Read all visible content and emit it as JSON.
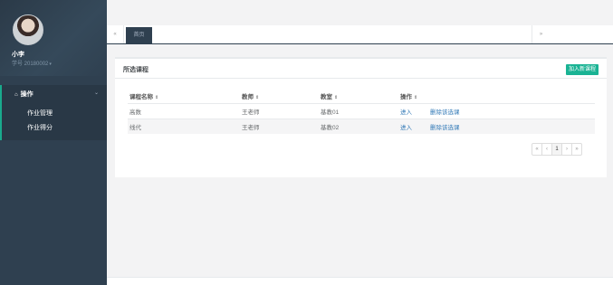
{
  "user": {
    "name": "小李",
    "id_label": "学号 20180002",
    "caret": "▾"
  },
  "nav": {
    "section_icon": "⌂",
    "section_label": "操作",
    "chevron": "⌄",
    "items": [
      {
        "label": "作业管理"
      },
      {
        "label": "作业得分"
      }
    ]
  },
  "tabs": {
    "prev": "«",
    "active_tab": "首页",
    "next": "»"
  },
  "panel": {
    "title": "所选课程",
    "add_button": "加入新课程",
    "sort_glyph": "⇕",
    "columns": [
      "课程名称",
      "教师",
      "教室",
      "操作"
    ],
    "rows": [
      {
        "course": "高数",
        "teacher": "王老师",
        "room": "基教01",
        "enter": "进入",
        "delete": "删除该选课"
      },
      {
        "course": "线代",
        "teacher": "王老师",
        "room": "基教02",
        "enter": "进入",
        "delete": "删除该选课"
      }
    ]
  },
  "pagination": {
    "first": "«",
    "prev": "‹",
    "current": "1",
    "next": "›",
    "last": "»"
  },
  "colors": {
    "sidebar": "#2f4050",
    "accent": "#1ab394",
    "link": "#337ab7"
  }
}
